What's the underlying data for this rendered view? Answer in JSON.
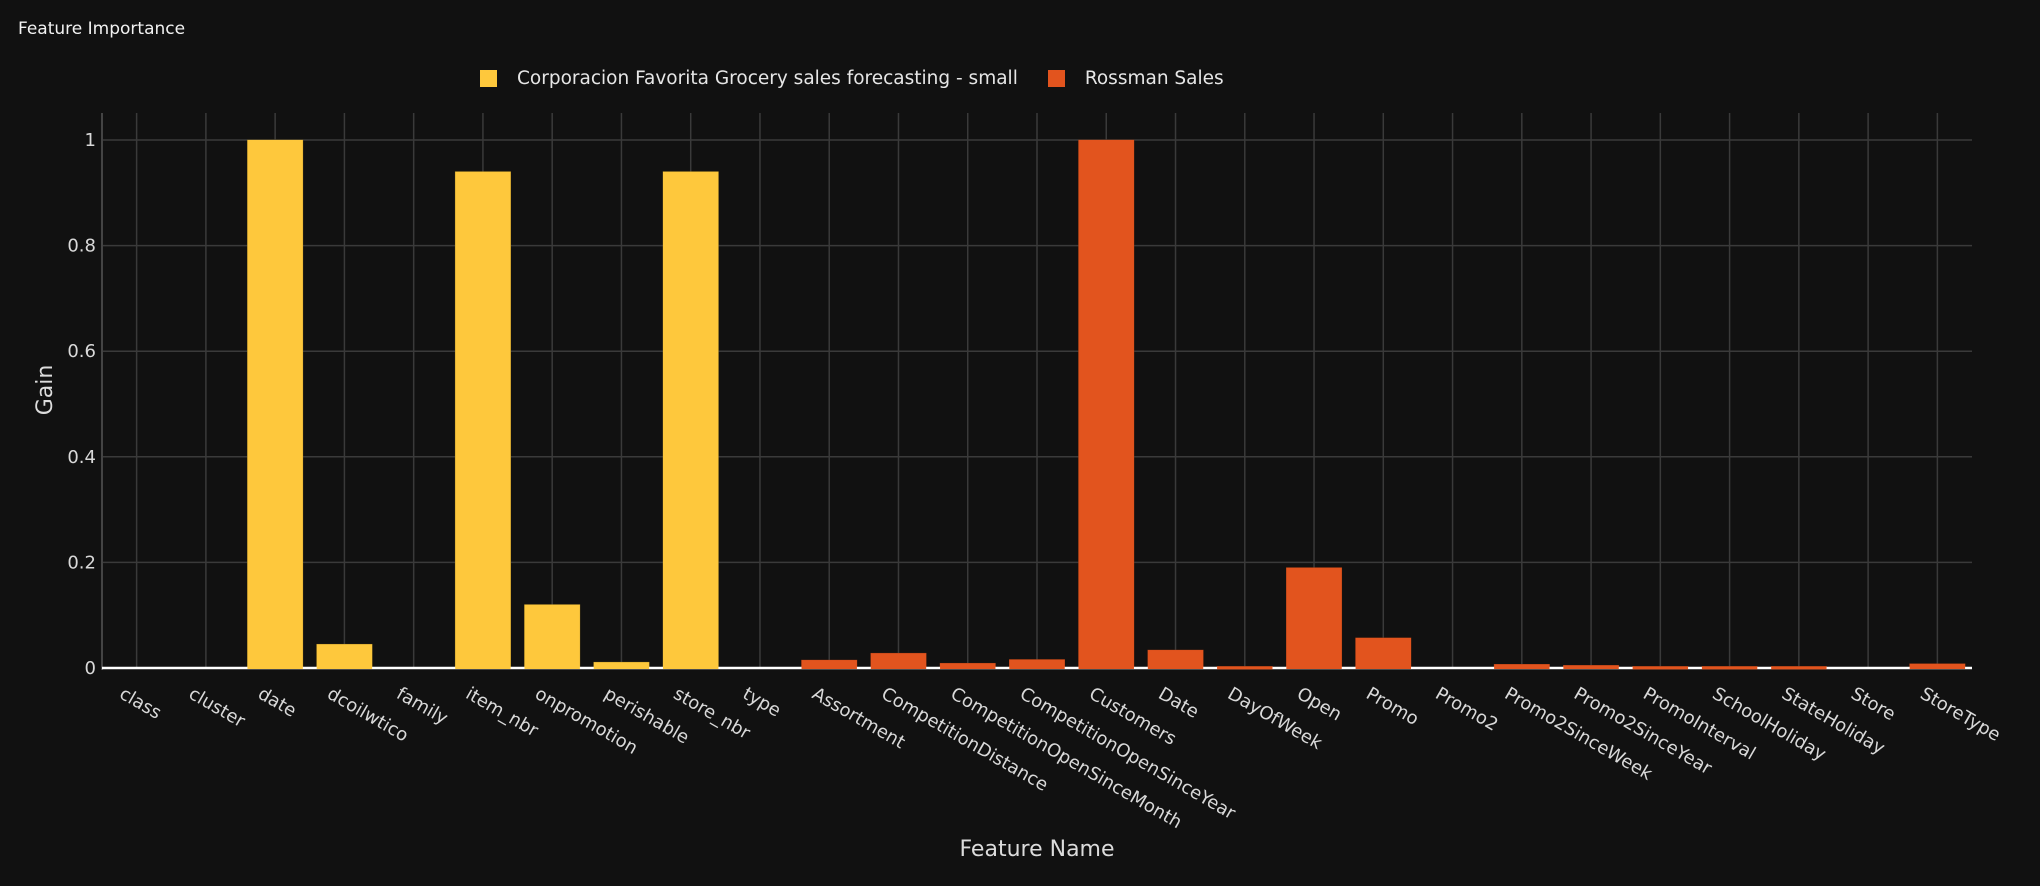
{
  "page": {
    "title": "Feature Importance"
  },
  "chart_data": {
    "type": "bar",
    "title": "Feature Importance",
    "xlabel": "Feature Name",
    "ylabel": "Gain",
    "ylim": [
      0,
      1.05
    ],
    "yticks": [
      0,
      0.2,
      0.4,
      0.6,
      0.8,
      1
    ],
    "ytick_labels": [
      "0",
      "0.2",
      "0.4",
      "0.6",
      "0.8",
      "1"
    ],
    "grid": true,
    "legend_position": "top-center",
    "categories": [
      "class",
      "cluster",
      "date",
      "dcoilwtico",
      "family",
      "item_nbr",
      "onpromotion",
      "perishable",
      "store_nbr",
      "type",
      "Assortment",
      "CompetitionDistance",
      "CompetitionOpenSinceMonth",
      "CompetitionOpenSinceYear",
      "Customers",
      "Date",
      "DayOfWeek",
      "Open",
      "Promo",
      "Promo2",
      "Promo2SinceWeek",
      "Promo2SinceYear",
      "PromoInterval",
      "SchoolHoliday",
      "StateHoliday",
      "Store",
      "StoreType"
    ],
    "series": [
      {
        "name": "Corporacion Favorita Grocery sales forecasting - small",
        "color": "#FEC83C",
        "points": [
          {
            "x": "class",
            "y": 0
          },
          {
            "x": "cluster",
            "y": 0
          },
          {
            "x": "date",
            "y": 1.0
          },
          {
            "x": "dcoilwtico",
            "y": 0.045
          },
          {
            "x": "family",
            "y": 0
          },
          {
            "x": "item_nbr",
            "y": 0.94
          },
          {
            "x": "onpromotion",
            "y": 0.12
          },
          {
            "x": "perishable",
            "y": 0.011
          },
          {
            "x": "store_nbr",
            "y": 0.94
          },
          {
            "x": "type",
            "y": 0
          }
        ]
      },
      {
        "name": "Rossman Sales",
        "color": "#E2541E",
        "points": [
          {
            "x": "Assortment",
            "y": 0.015
          },
          {
            "x": "CompetitionDistance",
            "y": 0.028
          },
          {
            "x": "CompetitionOpenSinceMonth",
            "y": 0.009
          },
          {
            "x": "CompetitionOpenSinceYear",
            "y": 0.016
          },
          {
            "x": "Customers",
            "y": 1.0
          },
          {
            "x": "Date",
            "y": 0.034
          },
          {
            "x": "DayOfWeek",
            "y": 0.003
          },
          {
            "x": "Open",
            "y": 0.19
          },
          {
            "x": "Promo",
            "y": 0.057
          },
          {
            "x": "Promo2",
            "y": 0
          },
          {
            "x": "Promo2SinceWeek",
            "y": 0.007
          },
          {
            "x": "Promo2SinceYear",
            "y": 0.005
          },
          {
            "x": "PromoInterval",
            "y": 0.003
          },
          {
            "x": "SchoolHoliday",
            "y": 0.003
          },
          {
            "x": "StateHoliday",
            "y": 0.003
          },
          {
            "x": "Store",
            "y": 0
          },
          {
            "x": "StoreType",
            "y": 0.008
          }
        ]
      }
    ]
  }
}
